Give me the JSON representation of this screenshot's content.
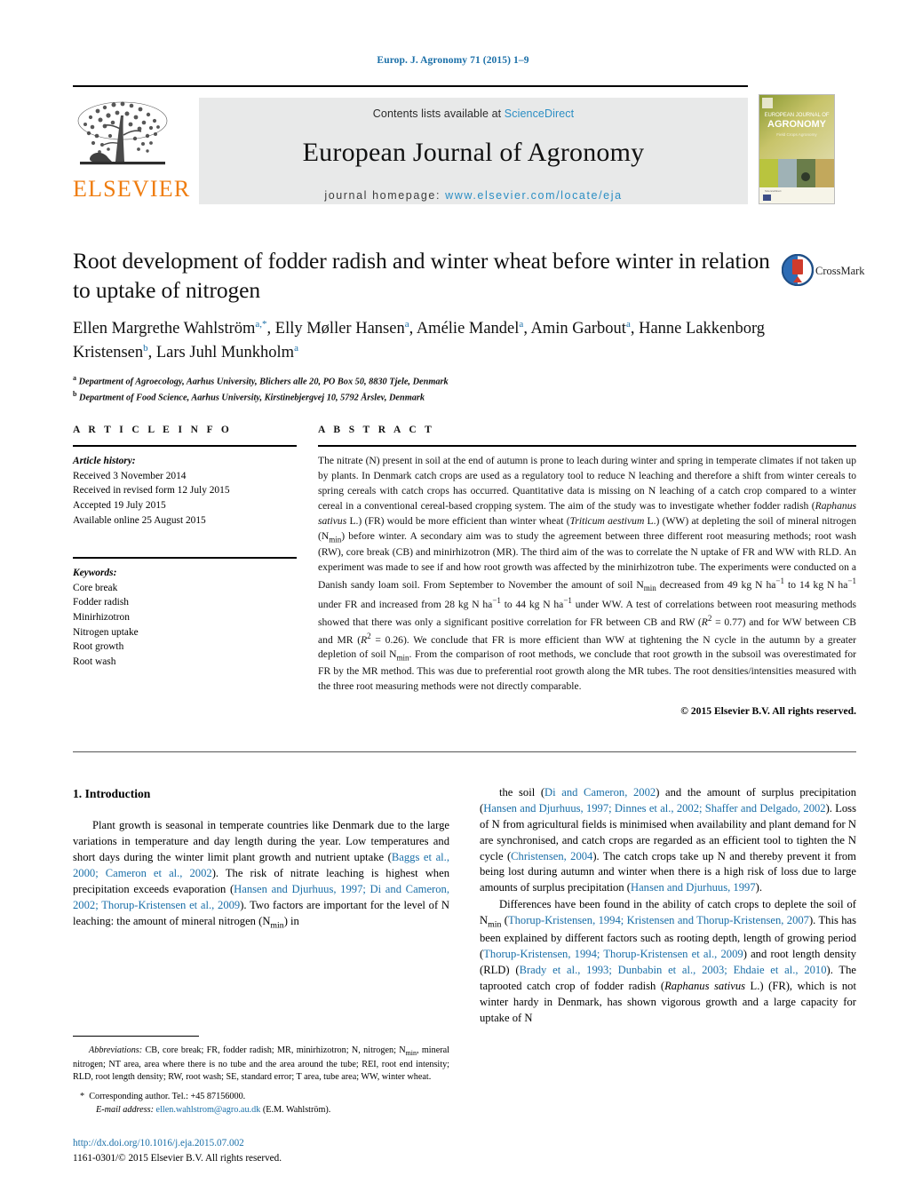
{
  "running_head": "Europ. J. Agronomy 71 (2015) 1–9",
  "masthead": {
    "contents_prefix": "Contents lists available at ",
    "sciencedirect": "ScienceDirect",
    "journal_name": "European Journal of Agronomy",
    "homepage_prefix": "journal homepage: ",
    "homepage_url": "www.elsevier.com/locate/eja",
    "publisher_logo_text": "ELSEVIER",
    "cover_title_line1": "EUROPEAN JOURNAL OF",
    "cover_title_line2": "AGRONOMY",
    "link_color": "#2b8ec4",
    "band_color": "#e8e9e9"
  },
  "crossmark": {
    "label": "CrossMark"
  },
  "title": "Root development of fodder radish and winter wheat before winter in relation to uptake of nitrogen",
  "authors_html": "Ellen Margrethe Wahlström<sup>a,*</sup>, Elly Møller Hansen<sup>a</sup>, Amélie Mandel<sup>a</sup>, Amin Garbout<sup>a</sup>, Hanne Lakkenborg Kristensen<sup>b</sup>, Lars Juhl Munkholm<sup>a</sup>",
  "affiliations": [
    "Department of Agroecology, Aarhus University, Blichers alle 20, PO Box 50, 8830 Tjele, Denmark",
    "Department of Food Science, Aarhus University, Kirstinebjergvej 10, 5792 Årslev, Denmark"
  ],
  "article_info": {
    "heading": "A R T I C L E   I N F O",
    "history_label": "Article history:",
    "history": [
      "Received 3 November 2014",
      "Received in revised form 12 July 2015",
      "Accepted 19 July 2015",
      "Available online 25 August 2015"
    ],
    "keywords_label": "Keywords:",
    "keywords": [
      "Core break",
      "Fodder radish",
      "Minirhizotron",
      "Nitrogen uptake",
      "Root growth",
      "Root wash"
    ]
  },
  "abstract": {
    "heading": "A B S T R A C T",
    "text_html": "The nitrate (N) present in soil at the end of autumn is prone to leach during winter and spring in temperate climates if not taken up by plants. In Denmark catch crops are used as a regulatory tool to reduce N leaching and therefore a shift from winter cereals to spring cereals with catch crops has occurred. Quantitative data is missing on N leaching of a catch crop compared to a winter cereal in a conventional cereal-based cropping system. The aim of the study was to investigate whether fodder radish (<i>Raphanus sativus</i> L.) (FR) would be more efficient than winter wheat (<i>Triticum aestivum</i> L.) (WW) at depleting the soil of mineral nitrogen (N<sub>min</sub>) before winter. A secondary aim was to study the agreement between three different root measuring methods; root wash (RW), core break (CB) and minirhizotron (MR). The third aim of the was to correlate the N uptake of FR and WW with RLD. An experiment was made to see if and how root growth was affected by the minirhizotron tube. The experiments were conducted on a Danish sandy loam soil. From September to November the amount of soil N<sub>min</sub> decreased from 49 kg N ha<sup>−1</sup> to 14 kg N ha<sup>−1</sup> under FR and increased from 28 kg N ha<sup>−1</sup> to 44 kg N ha<sup>−1</sup> under WW. A test of correlations between root measuring methods showed that there was only a significant positive correlation for FR between CB and RW (<i>R</i><sup>2</sup> = 0.77) and for WW between CB and MR (<i>R</i><sup>2</sup> = 0.26). We conclude that FR is more efficient than WW at tightening the N cycle in the autumn by a greater depletion of soil N<sub>min</sub>. From the comparison of root methods, we conclude that root growth in the subsoil was overestimated for FR by the MR method. This was due to preferential root growth along the MR tubes. The root densities/intensities measured with the three root measuring methods were not directly comparable.",
    "copyright": "© 2015 Elsevier B.V. All rights reserved."
  },
  "introduction": {
    "heading": "1.  Introduction",
    "left_paragraph_html": "Plant growth is seasonal in temperate countries like Denmark due to the large variations in temperature and day length during the year. Low temperatures and short days during the winter limit plant growth and nutrient uptake (<span class=\"ref\">Baggs et al., 2000; Cameron et al., 2002</span>). The risk of nitrate leaching is highest when precipitation exceeds evaporation (<span class=\"ref\">Hansen and Djurhuus, 1997; Di and Cameron, 2002; Thorup-Kristensen et al., 2009</span>). Two factors are important for the level of N leaching: the amount of mineral nitrogen (N<sub>min</sub>) in",
    "right_paragraph1_html": "the soil (<span class=\"ref\">Di and Cameron, 2002</span>) and the amount of surplus precipitation (<span class=\"ref\">Hansen and Djurhuus, 1997; Dinnes et al., 2002; Shaffer and Delgado, 2002</span>). Loss of N from agricultural fields is minimised when availability and plant demand for N are synchronised, and catch crops are regarded as an efficient tool to tighten the N cycle (<span class=\"ref\">Christensen, 2004</span>). The catch crops take up N and thereby prevent it from being lost during autumn and winter when there is a high risk of loss due to large amounts of surplus precipitation (<span class=\"ref\">Hansen and Djurhuus, 1997</span>).",
    "right_paragraph2_html": "Differences have been found in the ability of catch crops to deplete the soil of N<sub>min</sub> (<span class=\"ref\">Thorup-Kristensen, 1994; Kristensen and Thorup-Kristensen, 2007</span>). This has been explained by different factors such as rooting depth, length of growing period (<span class=\"ref\">Thorup-Kristensen, 1994; Thorup-Kristensen et al., 2009</span>) and root length density (RLD) (<span class=\"ref\">Brady et al., 1993; Dunbabin et al., 2003; Ehdaie et al., 2010</span>). The taprooted catch crop of fodder radish (<i>Raphanus sativus</i> L.) (FR), which is not winter hardy in Denmark, has shown vigorous growth and a large capacity for uptake of N"
  },
  "footnotes": {
    "abbreviations_html": "<span class=\"ital\">Abbreviations:</span> CB, core break; FR, fodder radish; MR, minirhizotron; N, nitrogen; N<sub>min</sub>, mineral nitrogen; NT area, area where there is no tube and the area around the tube; REI, root end intensity; RLD, root length density; RW, root wash; SE, standard error; T area, tube area; WW, winter wheat.",
    "corresponding_marker": "*",
    "corresponding_text": "Corresponding author. Tel.: +45 87156000.",
    "email_label": "E-mail address:",
    "email": "ellen.wahlstrom@agro.au.dk",
    "email_suffix": "(E.M. Wahlström)."
  },
  "doi": {
    "url": "http://dx.doi.org/10.1016/j.eja.2015.07.002",
    "issn_line": "1161-0301/© 2015 Elsevier B.V. All rights reserved."
  }
}
